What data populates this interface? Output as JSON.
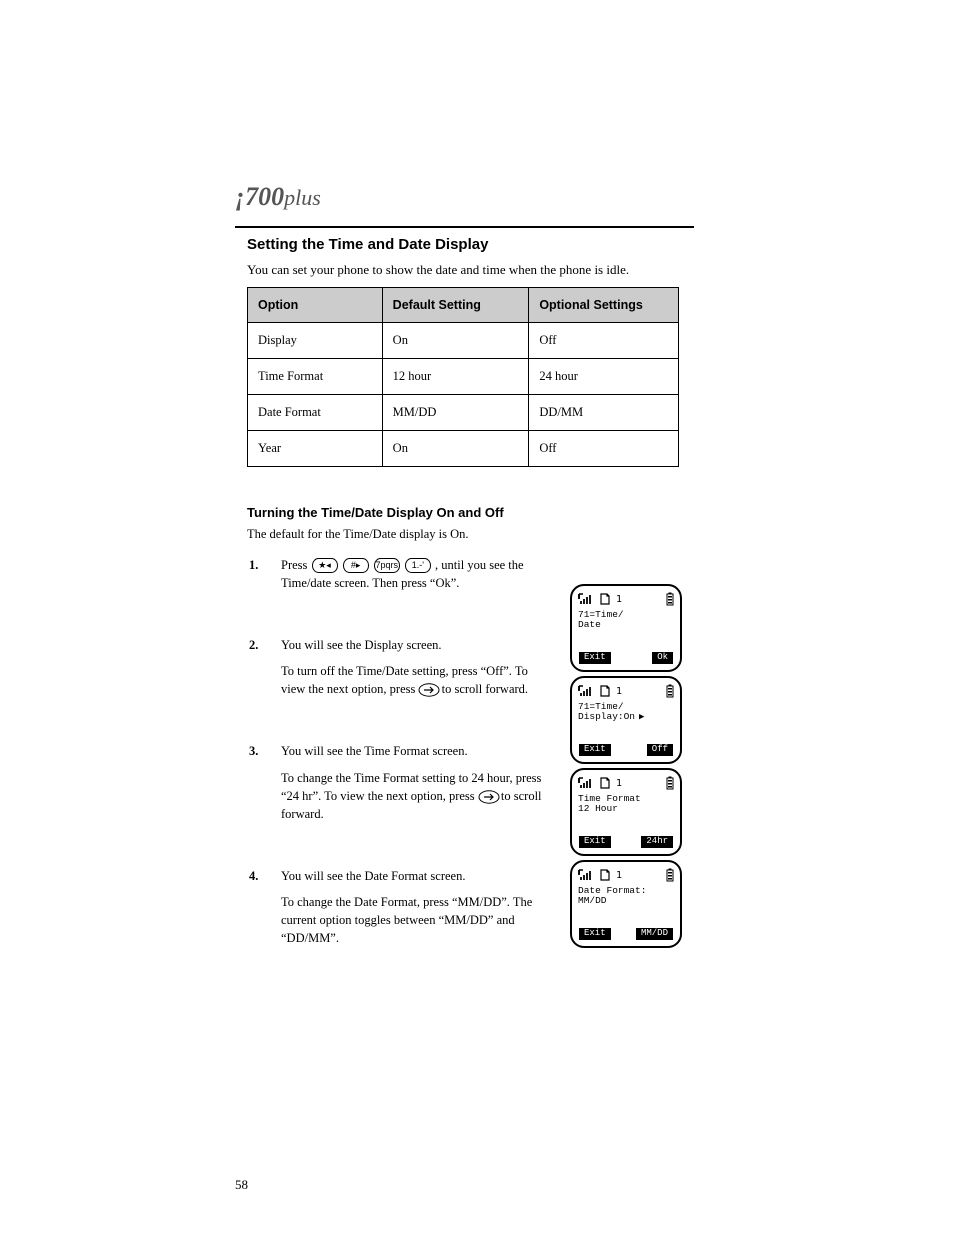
{
  "header": {
    "logo_i": "¡",
    "logo_num": "700",
    "logo_plus": "plus"
  },
  "section_title": "Setting the Time and Date Display",
  "intro": "You can set your phone to show the date and time when the phone is idle.",
  "table": {
    "headers": [
      "Option",
      "Default Setting",
      "Optional Settings"
    ],
    "rows": [
      [
        "Display",
        "On",
        "Off"
      ],
      [
        "Time Format",
        "12 hour",
        "24 hour"
      ],
      [
        "Date Format",
        "MM/DD",
        "DD/MM"
      ],
      [
        "Year",
        "On",
        "Off"
      ]
    ]
  },
  "subhead": "Turning the Time/Date Display On and Off",
  "body": "The default for the Time/Date display is On.",
  "steps": [
    {
      "num": "1.",
      "pre": "Press ",
      "keys": [
        "★◂",
        "#▸",
        "7pqrs",
        "1.-'"
      ],
      "post": ", until you see the Time/date screen. Then press “Ok”."
    },
    {
      "num": "2.",
      "text_top": "You will see the Display screen.",
      "text_sub_pre": "To turn off the Time/Date setting, press “Off”. To view the next option, press ",
      "text_sub_mid": " ",
      "text_sub_post": " to scroll forward."
    },
    {
      "num": "3.",
      "text_top": "You will see the Time Format screen.",
      "text_sub_pre": "To change the Time Format setting to 24 hour, press “24 hr”. To view the next option, press ",
      "text_sub_post": " to scroll forward."
    },
    {
      "num": "4.",
      "text_top": "You will see the Date Format screen.",
      "text_sub": "To change the Date Format, press “MM/DD”. The current option toggles between “MM/DD” and “DD/MM”."
    }
  ],
  "screens": [
    {
      "line1": "71=Time/",
      "line2": "Date",
      "arrow": false,
      "sk_left": "Exit",
      "sk_right": "Ok"
    },
    {
      "line1": "71=Time/",
      "line2": "Display:On",
      "arrow": true,
      "sk_left": "Exit",
      "sk_right": "Off"
    },
    {
      "line1": "Time Format",
      "line2": "12 Hour",
      "arrow": false,
      "sk_left": "Exit",
      "sk_right": "24hr"
    },
    {
      "line1": "Date Format:",
      "line2": "MM/DD",
      "arrow": false,
      "sk_left": "Exit",
      "sk_right": "MM/DD"
    }
  ],
  "statusbar": {
    "one": "1"
  },
  "pagenum": "58"
}
